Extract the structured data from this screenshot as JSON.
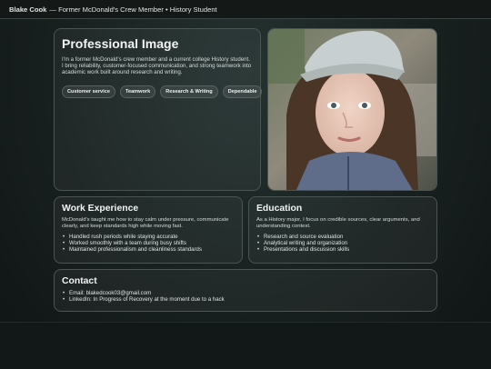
{
  "header": {
    "name": "Blake Cook",
    "tagline": "— Former McDonald's Crew Member • History Student"
  },
  "hero": {
    "title": "Professional Image",
    "description": "I'm a former McDonald's crew member and a current college History student. I bring reliability, customer-focused communication, and strong teamwork into academic work built around research and writing.",
    "tags": [
      "Customer service",
      "Teamwork",
      "Research & Writing",
      "Dependable"
    ]
  },
  "work": {
    "title": "Work Experience",
    "description": "McDonald's taught me how to stay calm under pressure, communicate clearly, and keep standards high while moving fast.",
    "items": [
      "Handled rush periods while staying accurate",
      "Worked smoothly with a team during busy shifts",
      "Maintained professionalism and cleanliness standards"
    ]
  },
  "education": {
    "title": "Education",
    "description": "As a History major, I focus on credible sources, clear arguments, and understanding context.",
    "items": [
      "Research and source evaluation",
      "Analytical writing and organization",
      "Presentations and discussion skills"
    ]
  },
  "contact": {
    "title": "Contact",
    "items": [
      "Email: blakedcook03@gmail.com",
      "LinkedIn: In Progress of Recovery at the moment due to a hack"
    ]
  }
}
